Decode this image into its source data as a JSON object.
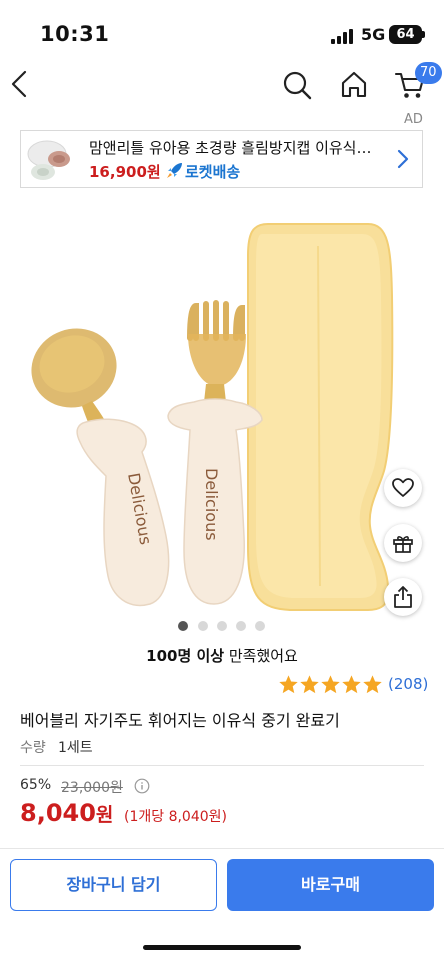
{
  "status_bar": {
    "time": "10:31",
    "network": "5G",
    "battery": "64"
  },
  "nav": {
    "cart_count": "70",
    "icons": [
      "back-icon",
      "search-icon",
      "home-icon",
      "cart-icon"
    ]
  },
  "ad": {
    "label": "AD",
    "title": "맘앤리틀 유아용 초경량 흘림방지캡 이유식…",
    "price": "16,900원",
    "delivery": "로켓배송"
  },
  "product_image": {
    "brand_text": "Delicious"
  },
  "gallery": {
    "total": 5,
    "active": 1
  },
  "satisfaction": {
    "bold": "100명 이상",
    "rest": " 만족했어요"
  },
  "rating": {
    "stars": 5,
    "count": "(208)"
  },
  "product": {
    "title": "베어블리 자기주도 휘어지는 이유식 중기 완료기",
    "qty_label": "수량",
    "qty_value": "1세트",
    "discount": "65%",
    "original_price": "23,000원",
    "price_number": "8,040",
    "price_unit": "원",
    "unit_price": "(1개당 8,040원)"
  },
  "buttons": {
    "cart": "장바구니 담기",
    "buy": "바로구매"
  },
  "colors": {
    "accent": "#3a7bec",
    "price_red": "#cc1e1e",
    "star": "#f5a623",
    "rocket_blue": "#1b75d0"
  }
}
